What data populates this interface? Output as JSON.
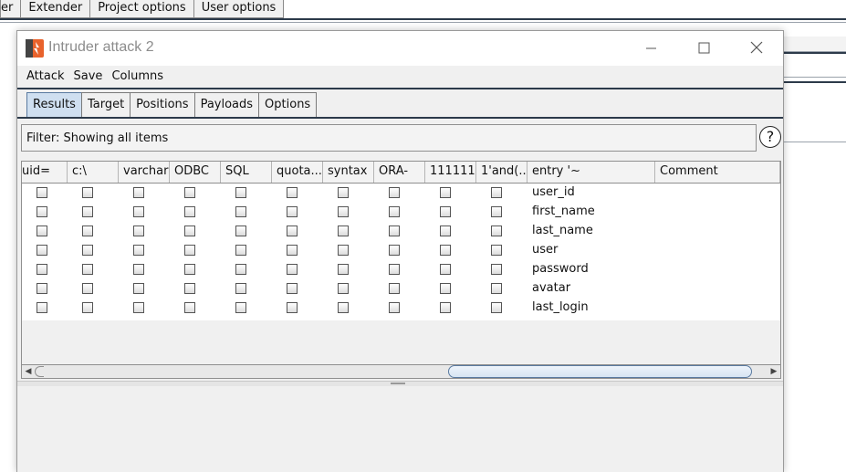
{
  "background_app": {
    "tabs": [
      "er",
      "Extender",
      "Project options",
      "User options"
    ]
  },
  "window": {
    "title": "Intruder attack 2",
    "controls": {
      "minimize": "—",
      "maximize": "☐",
      "close": "✕"
    }
  },
  "menu": [
    "Attack",
    "Save",
    "Columns"
  ],
  "tabs": [
    "Results",
    "Target",
    "Positions",
    "Payloads",
    "Options"
  ],
  "active_tab": "Results",
  "filter": {
    "text": "Filter: Showing all items"
  },
  "help": {
    "label": "?"
  },
  "table": {
    "columns": [
      "uid=",
      "c:\\",
      "varchar",
      "ODBC",
      "SQL",
      "quota...",
      "syntax",
      "ORA-",
      "111111",
      "1'and(...",
      "entry '~",
      "Comment"
    ],
    "rows": [
      {
        "entry": "user_id",
        "checks": [
          false,
          false,
          false,
          false,
          false,
          false,
          false,
          false,
          false,
          false
        ]
      },
      {
        "entry": "first_name",
        "checks": [
          false,
          false,
          false,
          false,
          false,
          false,
          false,
          false,
          false,
          false
        ]
      },
      {
        "entry": "last_name",
        "checks": [
          false,
          false,
          false,
          false,
          false,
          false,
          false,
          false,
          false,
          false
        ]
      },
      {
        "entry": "user",
        "checks": [
          false,
          false,
          false,
          false,
          false,
          false,
          false,
          false,
          false,
          false
        ]
      },
      {
        "entry": "password",
        "checks": [
          false,
          false,
          false,
          false,
          false,
          false,
          false,
          false,
          false,
          false
        ]
      },
      {
        "entry": "avatar",
        "checks": [
          false,
          false,
          false,
          false,
          false,
          false,
          false,
          false,
          false,
          false
        ]
      },
      {
        "entry": "last_login",
        "checks": [
          false,
          false,
          false,
          false,
          false,
          false,
          false,
          false,
          false,
          false
        ]
      }
    ]
  },
  "scrollbar": {
    "left_arrow": "◀",
    "right_arrow": "▶"
  }
}
